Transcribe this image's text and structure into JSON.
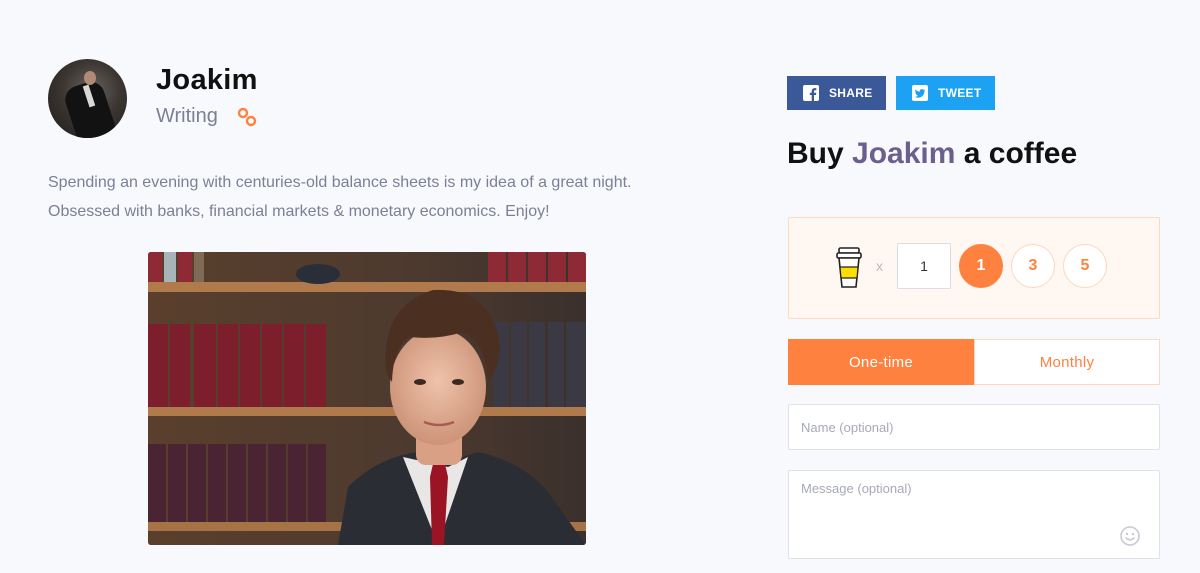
{
  "creator": {
    "name": "Joakim",
    "category": "Writing",
    "bio_lines": [
      "Spending an evening with centuries-old balance sheets is my idea of a great night.",
      "Obsessed with banks, financial markets & monetary economics. Enjoy!"
    ]
  },
  "icons": {
    "link": "link-icon",
    "facebook": "facebook-icon",
    "twitter": "twitter-icon",
    "coffee": "coffee-cup-icon",
    "emoji": "smiley-icon"
  },
  "share": {
    "facebook_label": "SHARE",
    "twitter_label": "TWEET"
  },
  "support": {
    "title_prefix": "Buy",
    "title_name": "Joakim",
    "title_suffix": "a coffee",
    "multiplier": "x",
    "quantity_value": "1",
    "quick_amounts": [
      "1",
      "3",
      "5"
    ],
    "selected_amount": "1",
    "frequency_tabs": [
      "One-time",
      "Monthly"
    ],
    "selected_frequency": "One-time",
    "name_placeholder": "Name (optional)",
    "message_placeholder": "Message (optional)"
  },
  "colors": {
    "accent": "#ff813f",
    "facebook": "#3b5998",
    "twitter": "#1da1f2",
    "muted_text": "#7c7f96",
    "name_highlight": "#6c5f8d"
  }
}
